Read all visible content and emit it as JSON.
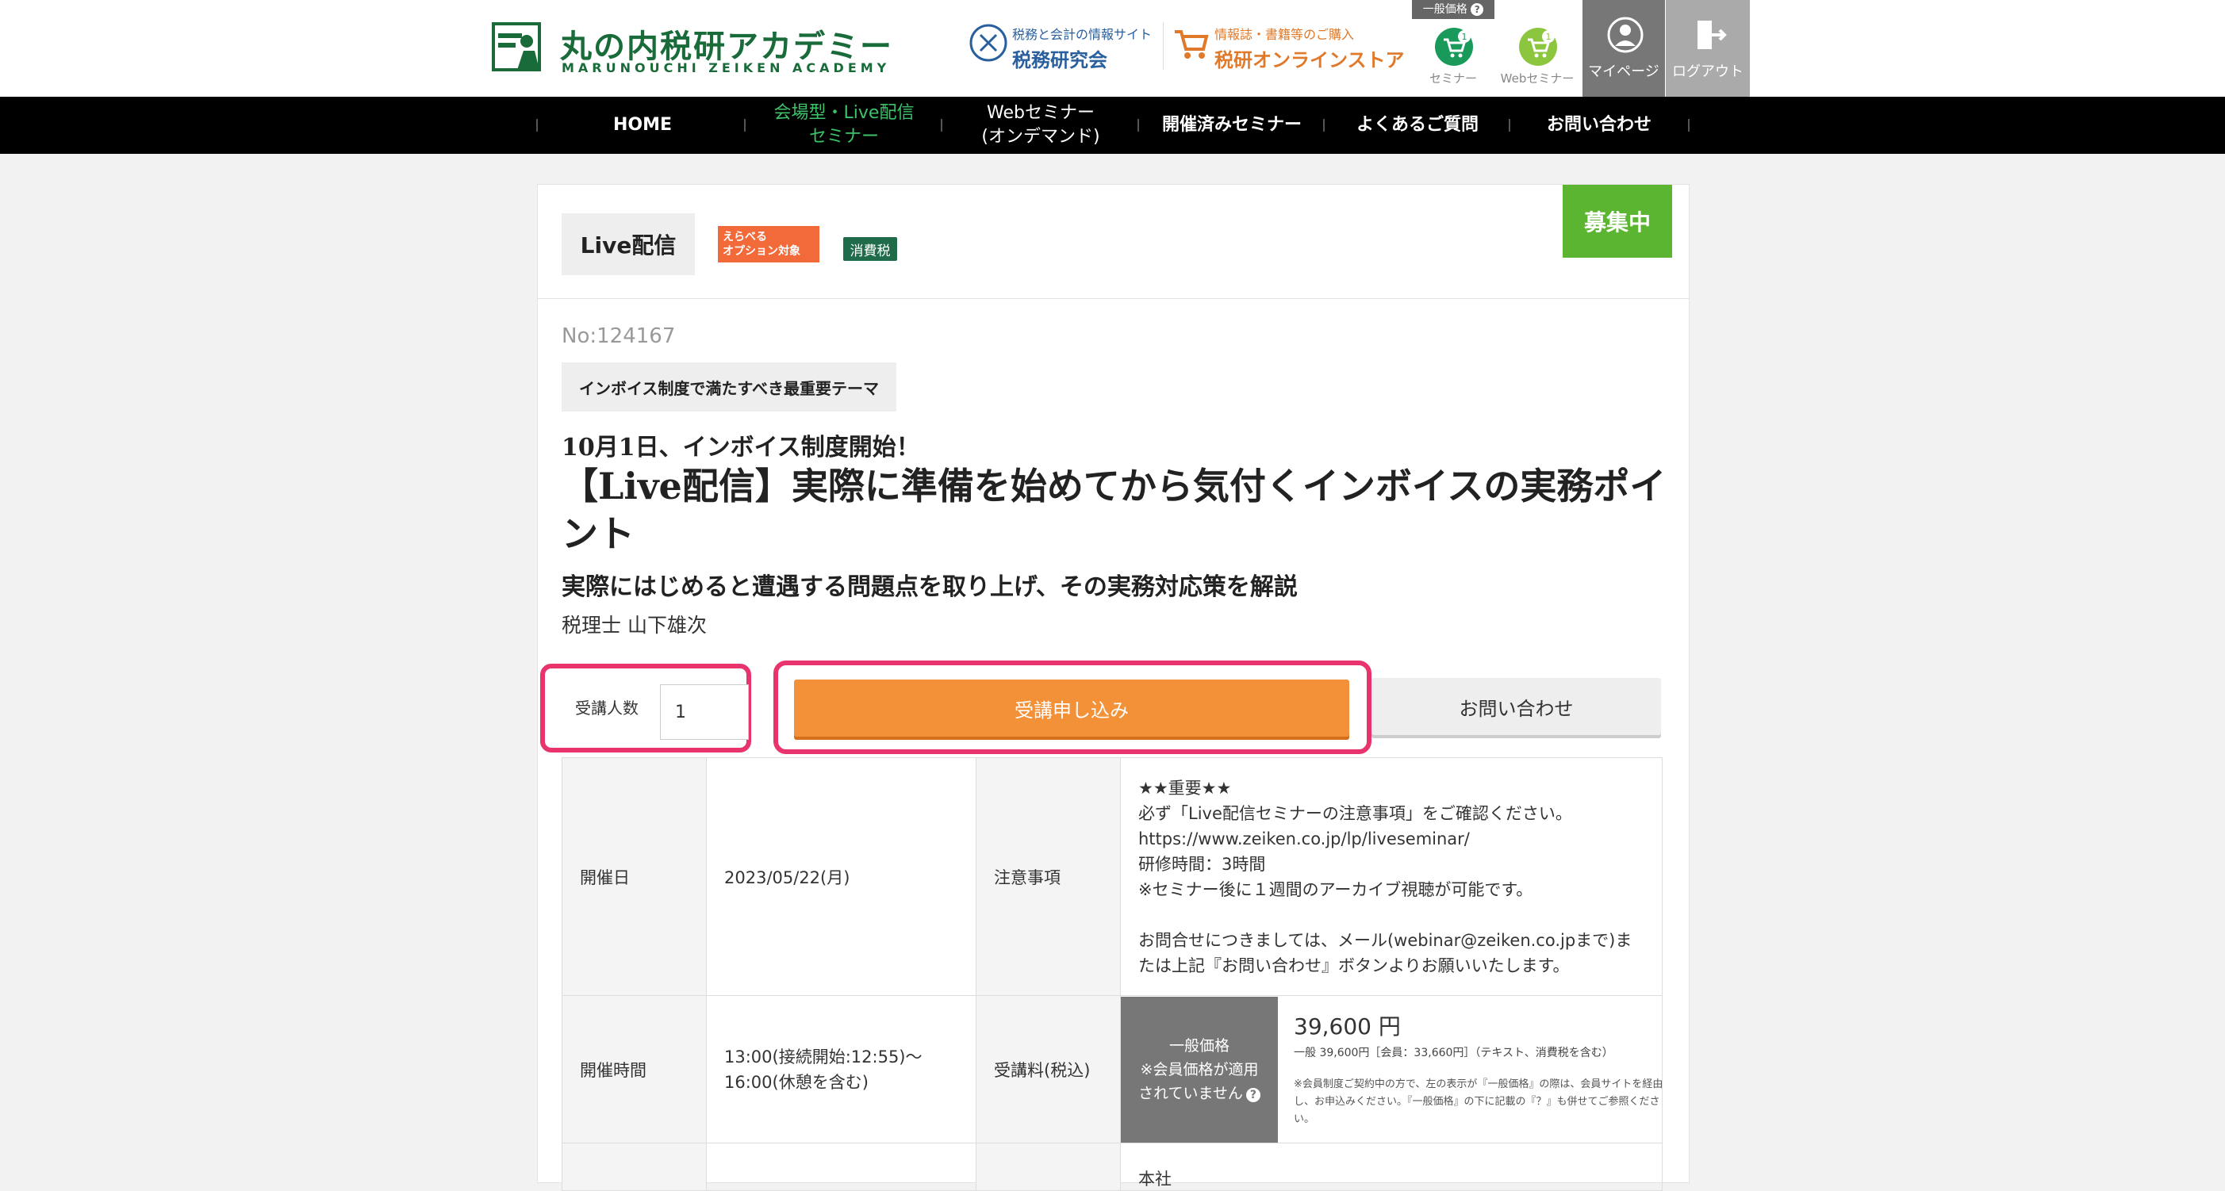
{
  "header": {
    "logo_title": "丸の内税研アカデミー",
    "logo_sub": "MARUNOUCHI ZEIKEN ACADEMY",
    "link1_small": "税務と会計の情報サイト",
    "link1_big": "税務研究会",
    "link2_small": "情報誌・書籍等のご購入",
    "link2_big": "税研オンラインストア",
    "cart_top_label": "一般価格",
    "cart1_label": "セミナー",
    "cart1_count": "1",
    "cart2_label": "Webセミナー",
    "cart2_count": "1",
    "mypage_label": "マイページ",
    "logout_label": "ログアウト"
  },
  "nav": {
    "items": [
      {
        "label": "HOME"
      },
      {
        "label": "会場型・Live配信\nセミナー"
      },
      {
        "label": "Webセミナー\n(オンデマンド)"
      },
      {
        "label": "開催済みセミナー"
      },
      {
        "label": "よくあるご質問"
      },
      {
        "label": "お問い合わせ"
      }
    ]
  },
  "seminar": {
    "type_tag": "Live配信",
    "option_tag": "えらべる\nオプション対象",
    "tax_tag": "消費税",
    "status": "募集中",
    "number": "No:124167",
    "theme": "インボイス制度で満たすべき最重要テーマ",
    "catch": "10月1日、インボイス制度開始！",
    "title": "【Live配信】実際に準備を始めてから気付くインボイスの実務ポイント",
    "subtitle": "実際にはじめると遭遇する問題点を取り上げ、その実務対応策を解説",
    "lecturer": "税理士 山下雄次"
  },
  "actions": {
    "qty_label": "受講人数",
    "qty_value": "1",
    "apply_label": "受講申し込み",
    "contact_label": "お問い合わせ"
  },
  "details": {
    "date_label": "開催日",
    "date_value": "2023/05/22(月)",
    "notes_label": "注意事項",
    "notes_lines": [
      "★★重要★★",
      "必ず「Live配信セミナーの注意事項」をご確認ください。",
      "https://www.zeiken.co.jp/lp/liveseminar/",
      "研修時間：3時間",
      "※セミナー後に１週間のアーカイブ視聴が可能です。",
      "",
      "お問合せにつきましては、メール(webinar@zeiken.co.jpまで)ま",
      "たは上記『お問い合わせ』ボタンよりお願いいたします。"
    ],
    "time_label": "開催時間",
    "time_value": "13:00(接続開始:12:55)〜\n16:00(休憩を含む)",
    "fee_label": "受講料(税込)",
    "price_badge_1": "一般価格",
    "price_badge_2": "※会員価格が適用",
    "price_badge_3": "されていません",
    "price_main": "39,600 円",
    "price_detail": "一般 39,600円［会員：33,660円］（テキスト、消費税を含む）",
    "price_note": "※会員制度ご契約中の方で、左の表示が『一般価格』の際は、会員サイトを経由し、お申込みください。『一般価格』の下に記載の『？』も併せてご参照ください。",
    "next_row_text": "本社"
  },
  "colors": {
    "brand_green": "#1a6b3a",
    "nav_active": "#3cc36a",
    "apply_orange": "#f39138",
    "highlight_pink": "#e8336d",
    "status_green": "#5cb531"
  }
}
